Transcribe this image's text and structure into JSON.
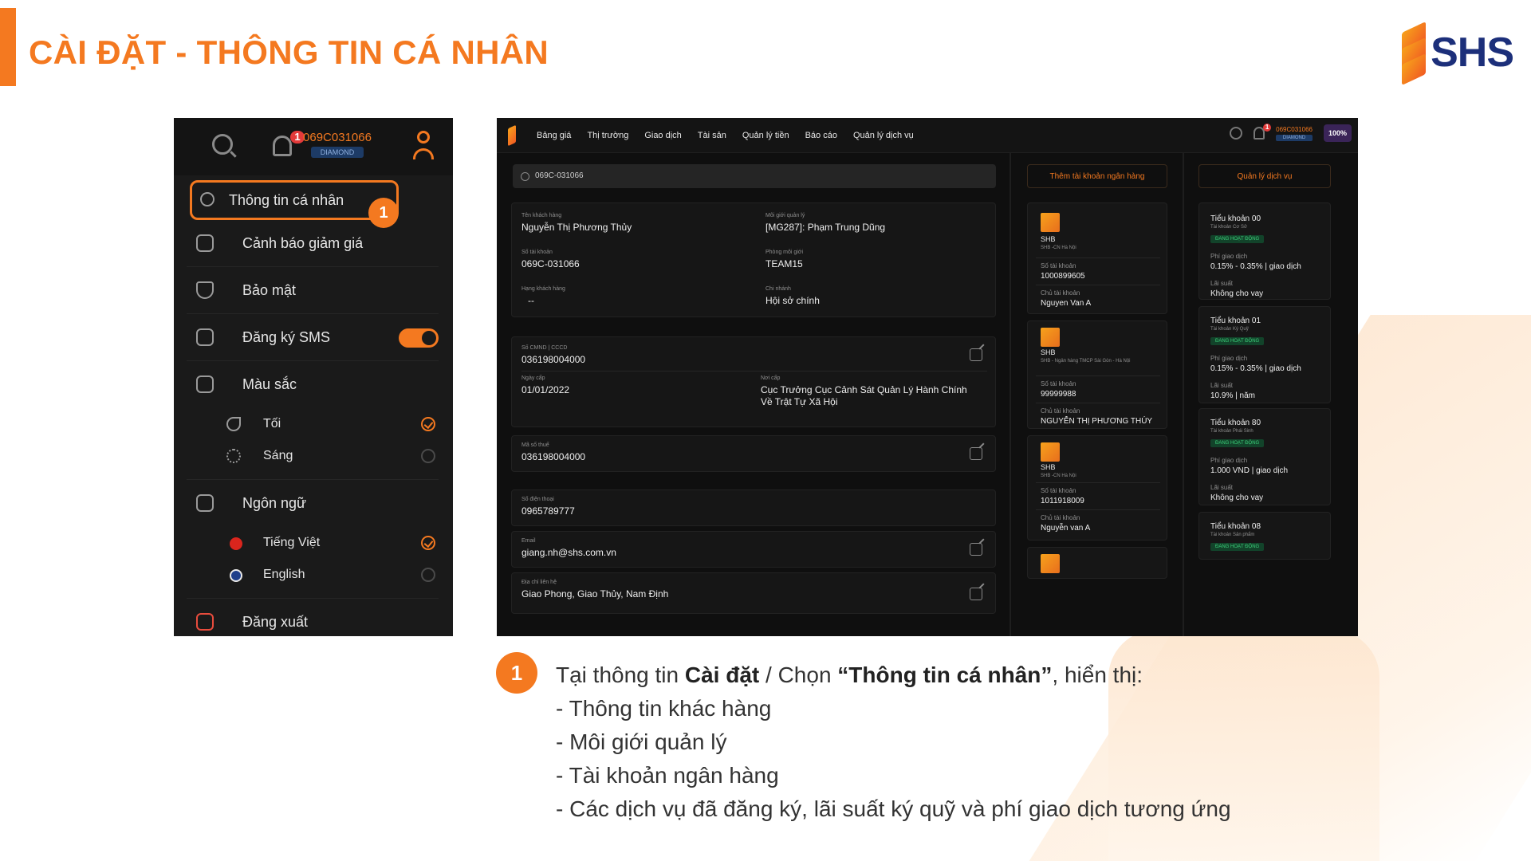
{
  "header": {
    "title": "CÀI ĐẶT - THÔNG TIN CÁ NHÂN",
    "logo_text": "SHS",
    "accent_color": "#f47920"
  },
  "menu_panel": {
    "account_code": "069C031066",
    "account_tier": "DIAMOND",
    "notification_count": "1",
    "items": [
      {
        "label": "Thông tin cá nhân",
        "icon": "user-icon",
        "selected": true
      },
      {
        "label": "Cảnh báo giảm giá",
        "icon": "alert-icon"
      },
      {
        "label": "Bảo mật",
        "icon": "shield-icon"
      },
      {
        "label": "Đăng ký SMS",
        "icon": "sms-icon",
        "toggle_on": true
      },
      {
        "label": "Màu sắc",
        "icon": "paint-icon"
      },
      {
        "label": "Ngôn ngữ",
        "icon": "language-icon"
      },
      {
        "label": "Đăng xuất",
        "icon": "logout-icon"
      }
    ],
    "theme_options": [
      {
        "label": "Tối",
        "icon": "moon-icon",
        "checked": true
      },
      {
        "label": "Sáng",
        "icon": "sun-icon",
        "checked": false
      }
    ],
    "language_options": [
      {
        "label": "Tiếng Việt",
        "icon": "flag-vn-icon",
        "checked": true
      },
      {
        "label": "English",
        "icon": "flag-uk-icon",
        "checked": false
      }
    ],
    "callout": "1"
  },
  "app": {
    "nav": [
      "Bảng giá",
      "Thị trường",
      "Giao dịch",
      "Tài sản",
      "Quản lý tiền",
      "Báo cáo",
      "Quản lý dịch vụ"
    ],
    "account_code": "069C031066",
    "account_tier": "DIAMOND",
    "notification_count": "1",
    "percent": "100%",
    "search_value": "069C-031066",
    "profile": {
      "customer_name_label": "Tên khách hàng",
      "customer_name": "Nguyễn Thị Phương Thủy",
      "account_no_label": "Số tài khoản",
      "account_no": "069C-031066",
      "rank_label": "Hạng khách hàng",
      "rank": "--",
      "broker_label": "Môi giới quản lý",
      "broker": "[MG287]: Phạm Trung Dũng",
      "broker_room_label": "Phòng môi giới",
      "broker_room": "TEAM15",
      "branch_label": "Chi nhánh",
      "branch": "Hội sở chính"
    },
    "identity": {
      "id_label": "Số CMND | CCCD",
      "id": "036198004000",
      "issue_date_label": "Ngày cấp",
      "issue_date": "01/01/2022",
      "issue_place_label": "Nơi cấp",
      "issue_place": "Cục Trưởng Cục Cảnh Sát Quản Lý Hành Chính Về Trật Tự Xã Hội"
    },
    "tax": {
      "label": "Mã số thuế",
      "value": "036198004000"
    },
    "phone": {
      "label": "Số điện thoại",
      "value": "0965789777"
    },
    "email": {
      "label": "Email",
      "value": "giang.nh@shs.com.vn"
    },
    "address": {
      "label": "Địa chỉ liên hệ",
      "value": "Giao Phong, Giao Thủy, Nam Định"
    },
    "add_bank_button": "Thêm tài khoản ngân hàng",
    "manage_service_button": "Quản lý dịch vụ",
    "banks": [
      {
        "name": "SHB",
        "branch": "SHB -CN Hà Nội",
        "acct_label": "Số tài khoản",
        "acct": "1000899605",
        "owner_label": "Chủ tài khoản",
        "owner": "Nguyen Van A"
      },
      {
        "name": "SHB",
        "branch": "SHB - Ngân hàng TMCP Sài Gòn - Hà Nội",
        "acct_label": "Số tài khoản",
        "acct": "99999988",
        "owner_label": "Chủ tài khoản",
        "owner": "NGUYỄN THỊ PHƯƠNG THÚY"
      },
      {
        "name": "SHB",
        "branch": "SHB -CN Hà Nội",
        "acct_label": "Số tài khoản",
        "acct": "1011918009",
        "owner_label": "Chủ tài khoản",
        "owner": "Nguyễn van A"
      }
    ],
    "services": [
      {
        "title": "Tiểu khoản 00",
        "sub": "Tài khoản Cơ Sở",
        "status": "ĐANG HOẠT ĐỘNG",
        "fee_label": "Phí giao dịch",
        "fee": "0.15% - 0.35% | giao dịch",
        "rate_label": "Lãi suất",
        "rate": "Không cho vay"
      },
      {
        "title": "Tiểu khoản 01",
        "sub": "Tài khoản Ký Quỹ",
        "status": "ĐANG HOẠT ĐỘNG",
        "fee_label": "Phí giao dịch",
        "fee": "0.15% - 0.35% | giao dịch",
        "rate_label": "Lãi suất",
        "rate": "10.9% | năm"
      },
      {
        "title": "Tiểu khoản 80",
        "sub": "Tài khoản Phái Sinh",
        "status": "ĐANG HOẠT ĐỘNG",
        "fee_label": "Phí giao dịch",
        "fee": "1.000 VND | giao dịch",
        "rate_label": "Lãi suất",
        "rate": "Không cho vay"
      },
      {
        "title": "Tiểu khoản 08",
        "sub": "Tài khoản Sản phẩm",
        "status": "ĐANG HOẠT ĐỘNG"
      }
    ]
  },
  "instructions": {
    "step": "1",
    "intro_prefix": "Tại thông tin ",
    "intro_bold_1": "Cài đặt",
    "intro_middle": " / Chọn ",
    "intro_bold_2": "“Thông tin cá nhân”",
    "intro_suffix": ", hiển thị:",
    "bullets": [
      "- Thông tin khác hàng",
      "- Môi giới quản lý",
      "- Tài khoản ngân hàng",
      "- Các dịch vụ đã đăng ký, lãi suất ký quỹ và phí giao dịch tương ứng"
    ]
  }
}
